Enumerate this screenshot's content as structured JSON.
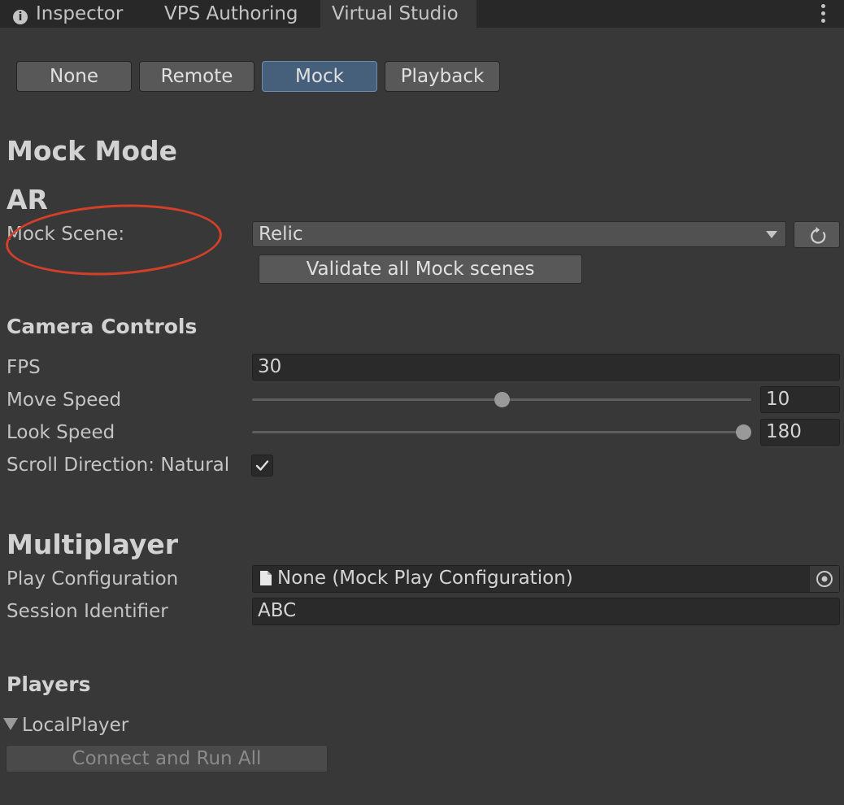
{
  "tabs": {
    "inspector": "Inspector",
    "vps_authoring": "VPS Authoring",
    "virtual_studio": "Virtual Studio",
    "active": "Virtual Studio"
  },
  "modes": {
    "none": "None",
    "remote": "Remote",
    "mock": "Mock",
    "playback": "Playback",
    "selected": "Mock"
  },
  "mock_mode": {
    "title": "Mock Mode",
    "ar_title": "AR",
    "mock_scene_label": "Mock Scene:",
    "mock_scene_value": "Relic",
    "validate_button": "Validate all Mock scenes"
  },
  "camera_controls": {
    "title": "Camera Controls",
    "fps_label": "FPS",
    "fps_value": "30",
    "move_speed_label": "Move Speed",
    "move_speed_value": "10",
    "move_speed_fill": 0.5,
    "look_speed_label": "Look Speed",
    "look_speed_value": "180",
    "look_speed_fill": 1.0,
    "scroll_direction_label": "Scroll Direction: Natural",
    "scroll_direction_checked": true
  },
  "multiplayer": {
    "title": "Multiplayer",
    "play_config_label": "Play Configuration",
    "play_config_value": "None (Mock Play Configuration)",
    "session_id_label": "Session Identifier",
    "session_id_value": "ABC"
  },
  "players": {
    "title": "Players",
    "local_player": "LocalPlayer",
    "connect_button": "Connect and Run All"
  },
  "colors": {
    "background": "#383838",
    "tab_bar": "#282828",
    "selected_button": "#46607c",
    "annotation_oval": "#d2402a"
  }
}
